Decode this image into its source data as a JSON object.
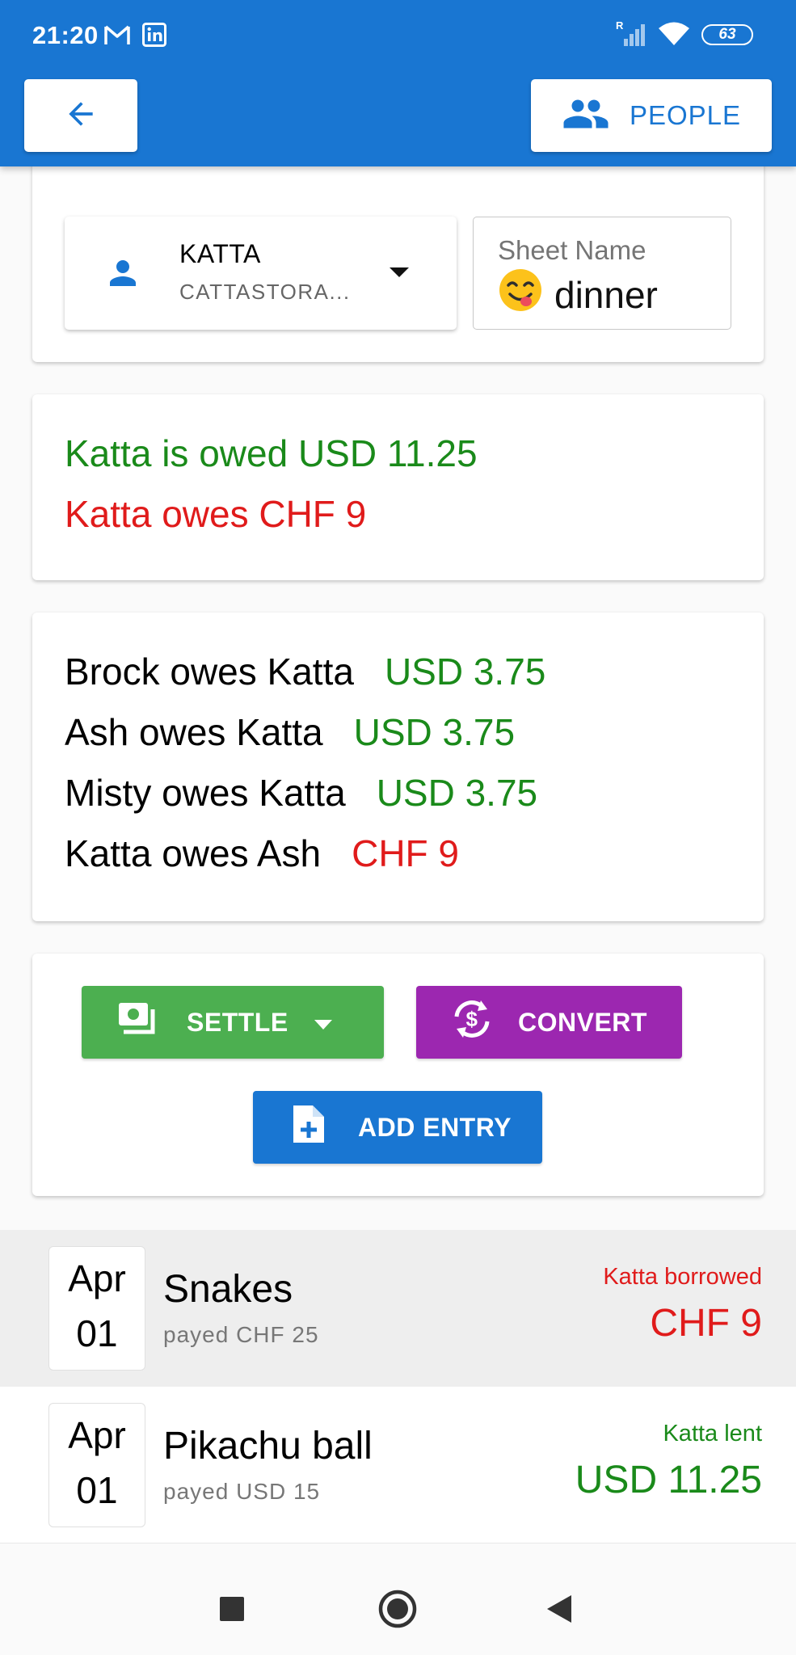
{
  "status_bar": {
    "time": "21:20",
    "battery": "63",
    "icons": [
      "gmail-icon",
      "linkedin-icon",
      "signal-icon",
      "wifi-icon",
      "battery-icon"
    ]
  },
  "app_bar": {
    "back_icon": "arrow-back-icon",
    "people_label": "PEOPLE",
    "people_icon": "people-icon"
  },
  "selector": {
    "person_name": "KATTA",
    "person_sub": "CATTASTORA...",
    "sheet_label": "Sheet Name",
    "sheet_value": "dinner",
    "sheet_emoji_icon": "yum-emoji-icon"
  },
  "summary": {
    "owed": "Katta is owed USD 11.25",
    "owes": "Katta owes CHF 9"
  },
  "debts": [
    {
      "text": "Brock owes Katta",
      "amount": "USD 3.75"
    },
    {
      "text": "Ash owes Katta",
      "amount": "USD 3.75"
    },
    {
      "text": "Misty owes Katta",
      "amount": "USD 3.75"
    },
    {
      "text": "Katta owes Ash",
      "amount": "CHF 9"
    }
  ],
  "actions": {
    "settle": "SETTLE",
    "convert": "CONVERT",
    "add_entry": "ADD ENTRY"
  },
  "entries": [
    {
      "month": "Apr",
      "day": "01",
      "title": "Snakes",
      "payed": "payed CHF 25",
      "who": "Katta borrowed",
      "amount": "CHF 9"
    },
    {
      "month": "Apr",
      "day": "01",
      "title": "Pikachu ball",
      "payed": "payed USD 15",
      "who": "Katta lent",
      "amount": "USD 11.25"
    }
  ],
  "colors": {
    "primary": "#1976d2",
    "positive": "#1a8a1a",
    "negative": "#e01b1b",
    "settle": "#4caf50",
    "convert": "#9c27b0"
  }
}
